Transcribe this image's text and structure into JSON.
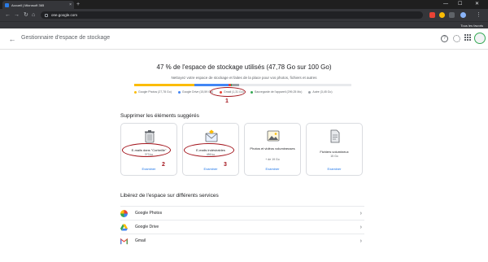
{
  "browser": {
    "tab_title": "Accueil | Microsoft 365",
    "new_tab": "+",
    "url": "one.google.com",
    "bookmarks_all": "Tous les favoris",
    "minimize": "—",
    "maximize": "☐",
    "close": "✕"
  },
  "app": {
    "title": "Gestionnaire d'espace de stockage",
    "back_icon": "arrow-back-icon",
    "help_icon": "help-icon",
    "settings_icon": "gear-icon",
    "apps_icon": "apps-grid-icon"
  },
  "storage": {
    "headline": "47 % de l'espace de stockage utilisés (47,78 Go sur 100 Go)",
    "subline": "Nettoyez votre espace de stockage et faites de la place pour vos photos, fichiers et autres",
    "usage": [
      {
        "label": "Google Photos (27,78 Go)",
        "fraction": 0.2778,
        "color": "#fbbc04"
      },
      {
        "label": "Google Drive (15,59 Go)",
        "fraction": 0.1559,
        "color": "#4285f4"
      },
      {
        "label": "Gmail (1,31 Go)",
        "fraction": 0.0131,
        "color": "#ea4335"
      },
      {
        "label": "Sauvegarde de l'appareil (299,25 Mo)",
        "fraction": 0.003,
        "color": "#34a853"
      },
      {
        "label": "Autre (3,45 Go)",
        "fraction": 0.0345,
        "color": "#9aa0a6"
      }
    ]
  },
  "suggestions": {
    "title": "Supprimer les éléments suggérés",
    "cards": [
      {
        "title": "E-mails dans \"Corbeille\"",
        "size": "373 ko",
        "action": "Examiner",
        "icon": "trash-icon"
      },
      {
        "title": "E-mails indésirables",
        "size": "486 ko",
        "action": "Examiner",
        "icon": "spam-mail-icon"
      },
      {
        "title": "Photos et vidéos volumineuses",
        "size": "+ de 19 Go",
        "action": "Examiner",
        "icon": "photo-icon"
      },
      {
        "title": "Fichiers volumineux",
        "size": "15 Go",
        "action": "Examiner",
        "icon": "file-icon"
      }
    ]
  },
  "annotations": [
    "1",
    "2",
    "3"
  ],
  "services": {
    "title": "Libérez de l'espace sur différents services",
    "items": [
      {
        "label": "Google Photos",
        "icon": "google-photos-icon"
      },
      {
        "label": "Google Drive",
        "icon": "google-drive-icon"
      },
      {
        "label": "Gmail",
        "icon": "gmail-icon"
      }
    ]
  }
}
